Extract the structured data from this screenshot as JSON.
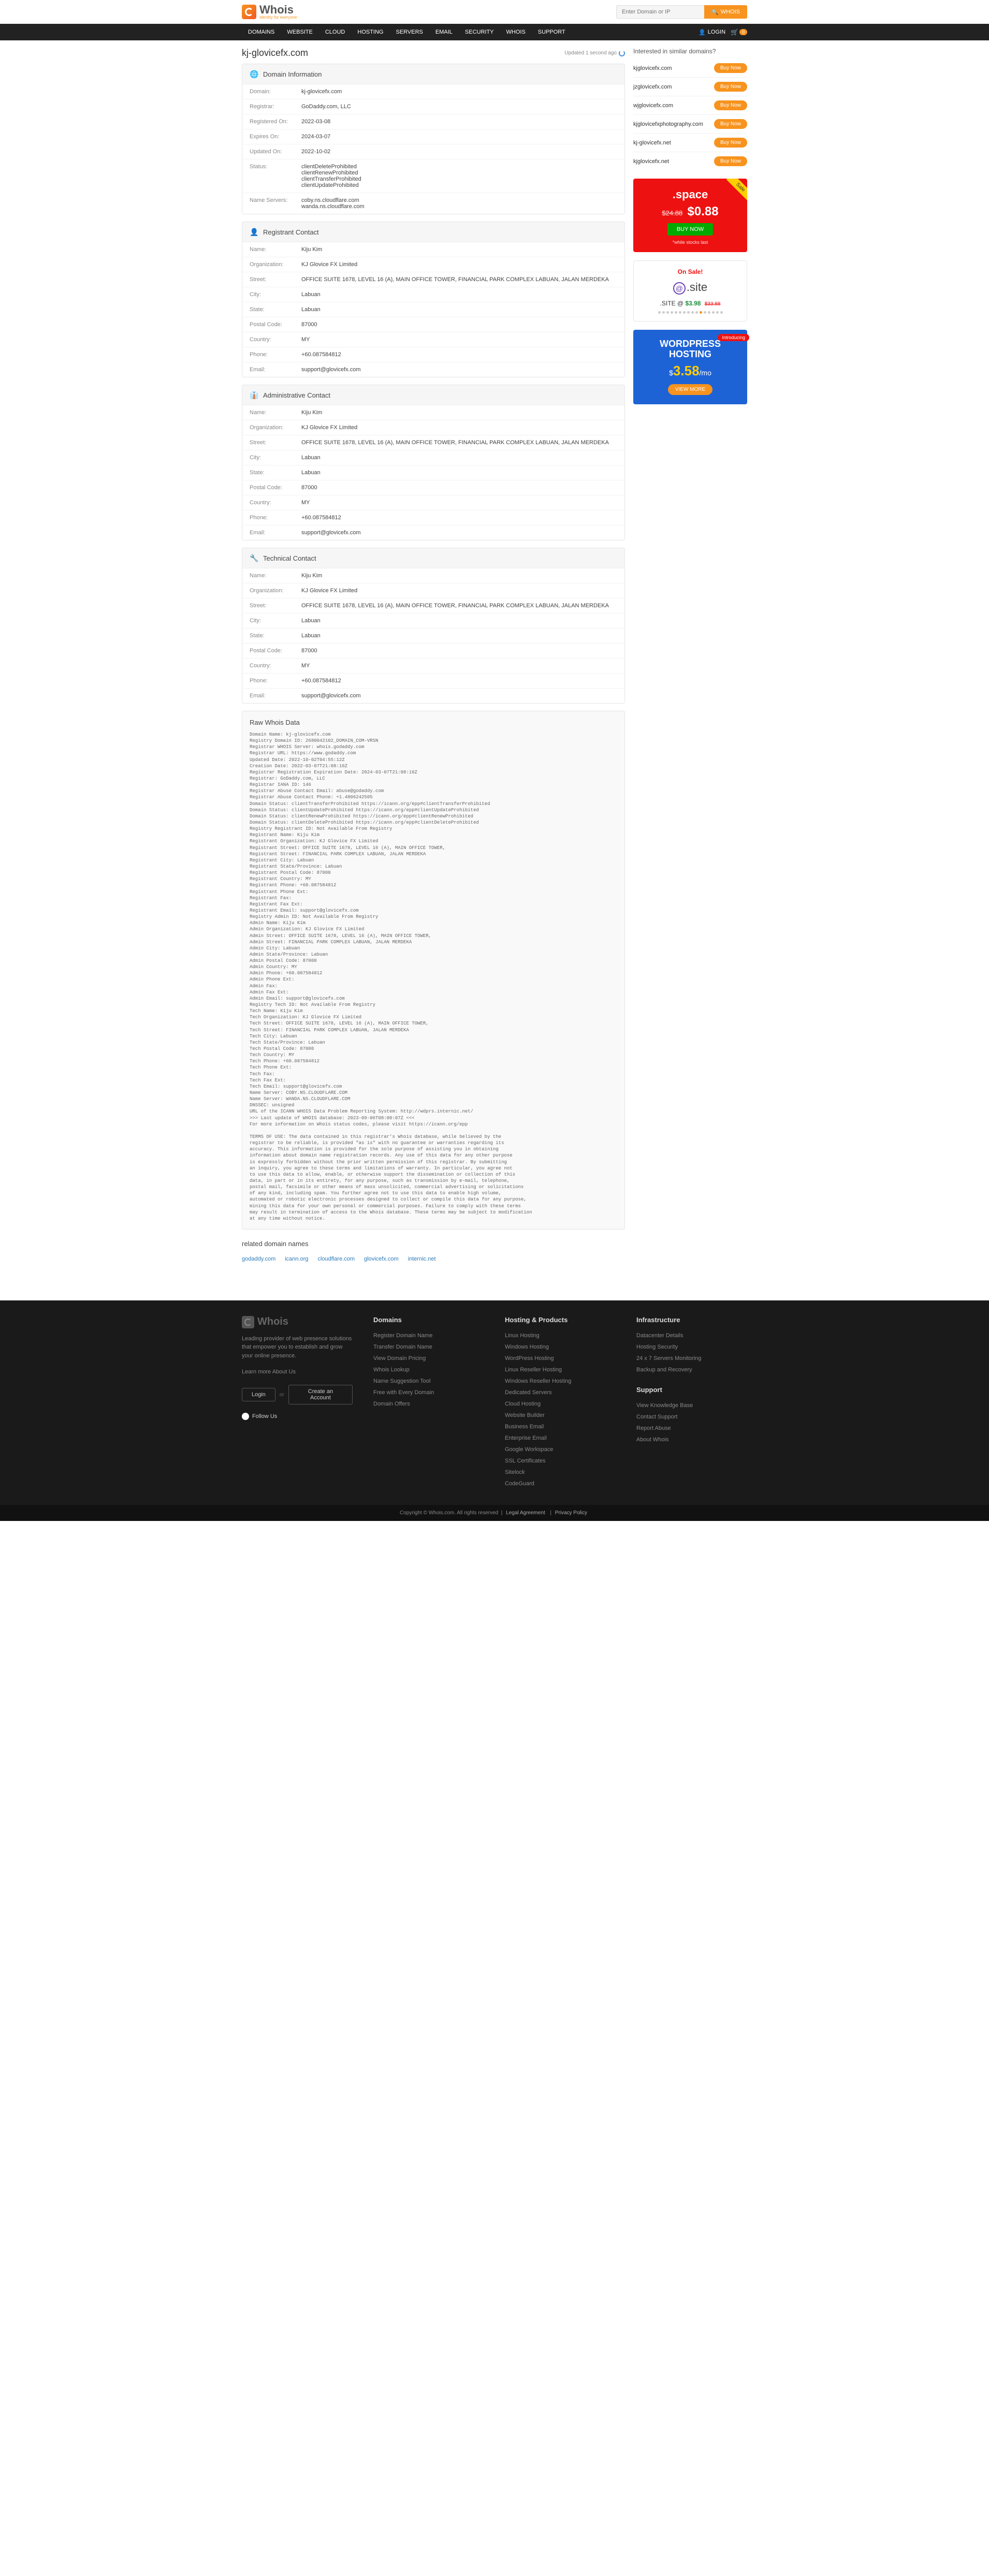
{
  "brand": {
    "name": "Whois",
    "tagline": "Identity for everyone"
  },
  "search": {
    "placeholder": "Enter Domain or IP",
    "btn": "WHOIS"
  },
  "nav": {
    "items": [
      "DOMAINS",
      "WEBSITE",
      "CLOUD",
      "HOSTING",
      "SERVERS",
      "EMAIL",
      "SECURITY",
      "WHOIS",
      "SUPPORT"
    ],
    "login": "LOGIN",
    "cart_count": "0"
  },
  "page": {
    "title": "kj-glovicefx.com",
    "updated": "Updated 1 second ago"
  },
  "domain_info": {
    "heading": "Domain Information",
    "rows": [
      {
        "k": "Domain:",
        "v": "kj-glovicefx.com"
      },
      {
        "k": "Registrar:",
        "v": "GoDaddy.com, LLC"
      },
      {
        "k": "Registered On:",
        "v": "2022-03-08"
      },
      {
        "k": "Expires On:",
        "v": "2024-03-07"
      },
      {
        "k": "Updated On:",
        "v": "2022-10-02"
      },
      {
        "k": "Status:",
        "v": "clientDeleteProhibited\nclientRenewProhibited\nclientTransferProhibited\nclientUpdateProhibited"
      },
      {
        "k": "Name Servers:",
        "v": "coby.ns.cloudflare.com\nwanda.ns.cloudflare.com"
      }
    ]
  },
  "contacts": [
    {
      "heading": "Registrant Contact",
      "icon": "👤",
      "rows": [
        {
          "k": "Name:",
          "v": "Kiju Kim"
        },
        {
          "k": "Organization:",
          "v": "KJ Glovice FX Limited"
        },
        {
          "k": "Street:",
          "v": "OFFICE SUITE 1678, LEVEL 16 (A), MAIN OFFICE TOWER, FINANCIAL PARK COMPLEX LABUAN, JALAN MERDEKA"
        },
        {
          "k": "City:",
          "v": "Labuan"
        },
        {
          "k": "State:",
          "v": "Labuan"
        },
        {
          "k": "Postal Code:",
          "v": "87000"
        },
        {
          "k": "Country:",
          "v": "MY"
        },
        {
          "k": "Phone:",
          "v": "+60.087584812"
        },
        {
          "k": "Email:",
          "v": "support@glovicefx.com"
        }
      ]
    },
    {
      "heading": "Administrative Contact",
      "icon": "👔",
      "rows": [
        {
          "k": "Name:",
          "v": "Kiju Kim"
        },
        {
          "k": "Organization:",
          "v": "KJ Glovice FX Limited"
        },
        {
          "k": "Street:",
          "v": "OFFICE SUITE 1678, LEVEL 16 (A), MAIN OFFICE TOWER, FINANCIAL PARK COMPLEX LABUAN, JALAN MERDEKA"
        },
        {
          "k": "City:",
          "v": "Labuan"
        },
        {
          "k": "State:",
          "v": "Labuan"
        },
        {
          "k": "Postal Code:",
          "v": "87000"
        },
        {
          "k": "Country:",
          "v": "MY"
        },
        {
          "k": "Phone:",
          "v": "+60.087584812"
        },
        {
          "k": "Email:",
          "v": "support@glovicefx.com"
        }
      ]
    },
    {
      "heading": "Technical Contact",
      "icon": "🔧",
      "rows": [
        {
          "k": "Name:",
          "v": "Kiju Kim"
        },
        {
          "k": "Organization:",
          "v": "KJ Glovice FX Limited"
        },
        {
          "k": "Street:",
          "v": "OFFICE SUITE 1678, LEVEL 16 (A), MAIN OFFICE TOWER, FINANCIAL PARK COMPLEX LABUAN, JALAN MERDEKA"
        },
        {
          "k": "City:",
          "v": "Labuan"
        },
        {
          "k": "State:",
          "v": "Labuan"
        },
        {
          "k": "Postal Code:",
          "v": "87000"
        },
        {
          "k": "Country:",
          "v": "MY"
        },
        {
          "k": "Phone:",
          "v": "+60.087584812"
        },
        {
          "k": "Email:",
          "v": "support@glovicefx.com"
        }
      ]
    }
  ],
  "raw": {
    "heading": "Raw Whois Data",
    "text": "Domain Name: kj-glovicefx.com\nRegistry Domain ID: 2680042102_DOMAIN_COM-VRSN\nRegistrar WHOIS Server: whois.godaddy.com\nRegistrar URL: https://www.godaddy.com\nUpdated Date: 2022-10-02T04:55:12Z\nCreation Date: 2022-03-07T21:08:16Z\nRegistrar Registration Expiration Date: 2024-03-07T21:08:16Z\nRegistrar: GoDaddy.com, LLC\nRegistrar IANA ID: 146\nRegistrar Abuse Contact Email: abuse@godaddy.com\nRegistrar Abuse Contact Phone: +1.4806242505\nDomain Status: clientTransferProhibited https://icann.org/epp#clientTransferProhibited\nDomain Status: clientUpdateProhibited https://icann.org/epp#clientUpdateProhibited\nDomain Status: clientRenewProhibited https://icann.org/epp#clientRenewProhibited\nDomain Status: clientDeleteProhibited https://icann.org/epp#clientDeleteProhibited\nRegistry Registrant ID: Not Available From Registry\nRegistrant Name: Kiju Kim\nRegistrant Organization: KJ Glovice FX Limited\nRegistrant Street: OFFICE SUITE 1678, LEVEL 16 (A), MAIN OFFICE TOWER,\nRegistrant Street: FINANCIAL PARK COMPLEX LABUAN, JALAN MERDEKA\nRegistrant City: Labuan\nRegistrant State/Province: Labuan\nRegistrant Postal Code: 87000\nRegistrant Country: MY\nRegistrant Phone: +60.087584812\nRegistrant Phone Ext:\nRegistrant Fax:\nRegistrant Fax Ext:\nRegistrant Email: support@glovicefx.com\nRegistry Admin ID: Not Available From Registry\nAdmin Name: Kiju Kim\nAdmin Organization: KJ Glovice FX Limited\nAdmin Street: OFFICE SUITE 1678, LEVEL 16 (A), MAIN OFFICE TOWER,\nAdmin Street: FINANCIAL PARK COMPLEX LABUAN, JALAN MERDEKA\nAdmin City: Labuan\nAdmin State/Province: Labuan\nAdmin Postal Code: 87000\nAdmin Country: MY\nAdmin Phone: +60.087584812\nAdmin Phone Ext:\nAdmin Fax:\nAdmin Fax Ext:\nAdmin Email: support@glovicefx.com\nRegistry Tech ID: Not Available From Registry\nTech Name: Kiju Kim\nTech Organization: KJ Glovice FX Limited\nTech Street: OFFICE SUITE 1678, LEVEL 16 (A), MAIN OFFICE TOWER,\nTech Street: FINANCIAL PARK COMPLEX LABUAN, JALAN MERDEKA\nTech City: Labuan\nTech State/Province: Labuan\nTech Postal Code: 87000\nTech Country: MY\nTech Phone: +60.087584812\nTech Phone Ext:\nTech Fax:\nTech Fax Ext:\nTech Email: support@glovicefx.com\nName Server: COBY.NS.CLOUDFLARE.COM\nName Server: WANDA.NS.CLOUDFLARE.COM\nDNSSEC: unsigned\nURL of the ICANN WHOIS Data Problem Reporting System: http://wdprs.internic.net/\n>>> Last update of WHOIS database: 2023-09-06T08:00:07Z <<<\nFor more information on Whois status codes, please visit https://icann.org/epp\n\nTERMS OF USE: The data contained in this registrar's Whois database, while believed by the\nregistrar to be reliable, is provided \"as is\" with no guarantee or warranties regarding its\naccuracy. This information is provided for the sole purpose of assisting you in obtaining\ninformation about domain name registration records. Any use of this data for any other purpose\nis expressly forbidden without the prior written permission of this registrar. By submitting\nan inquiry, you agree to these terms and limitations of warranty. In particular, you agree not\nto use this data to allow, enable, or otherwise support the dissemination or collection of this\ndata, in part or in its entirety, for any purpose, such as transmission by e-mail, telephone,\npostal mail, facsimile or other means of mass unsolicited, commercial advertising or solicitations\nof any kind, including spam. You further agree not to use this data to enable high volume,\nautomated or robotic electronic processes designed to collect or compile this data for any purpose,\nmining this data for your own personal or commercial purposes. Failure to comply with these terms\nmay result in termination of access to the Whois database. These terms may be subject to modification\nat any time without notice."
  },
  "related": {
    "heading": "related domain names",
    "links": [
      "godaddy.com",
      "icann.org",
      "cloudflare.com",
      "glovicefx.com",
      "internic.net"
    ]
  },
  "similar": {
    "heading": "Interested in similar domains?",
    "items": [
      {
        "name": "kjglovicefx.com",
        "btn": "Buy Now"
      },
      {
        "name": "jzglovicefx.com",
        "btn": "Buy Now"
      },
      {
        "name": "wjglovicefx.com",
        "btn": "Buy Now"
      },
      {
        "name": "kjglovicefxphotography.com",
        "btn": "Buy Now"
      },
      {
        "name": "kj-glovicefx.net",
        "btn": "Buy Now"
      },
      {
        "name": "kjglovicefx.net",
        "btn": "Buy Now"
      }
    ]
  },
  "promo_space": {
    "badge": "Sale",
    "tld": ".space",
    "old": "$24.88",
    "new": "$0.88",
    "btn": "BUY NOW",
    "stock": "*while stocks last"
  },
  "promo_site": {
    "onsale": "On Sale!",
    "logo": ".site",
    "line": ".SITE @ ",
    "now": "$3.98",
    "was": "$33.88"
  },
  "promo_wp": {
    "intro": "Introducing",
    "title1": "WORDPRESS",
    "title2": "HOSTING",
    "currency": "$",
    "big": "3.58",
    "per": "/mo",
    "btn": "VIEW MORE"
  },
  "footer": {
    "tagline": "Leading provider of web presence solutions that empower you to establish and grow your online presence.",
    "learn": "Learn more About Us",
    "login": "Login",
    "or": "or",
    "create": "Create an Account",
    "follow": "Follow Us",
    "cols": [
      {
        "h": "Domains",
        "links": [
          "Register Domain Name",
          "Transfer Domain Name",
          "View Domain Pricing",
          "Whois Lookup",
          "Name Suggestion Tool",
          "Free with Every Domain",
          "Domain Offers"
        ]
      },
      {
        "h": "Hosting & Products",
        "links": [
          "Linux Hosting",
          "Windows Hosting",
          "WordPress Hosting",
          "Linux Reseller Hosting",
          "Windows Reseller Hosting",
          "Dedicated Servers",
          "Cloud Hosting",
          "Website Builder",
          "Business Email",
          "Enterprise Email",
          "Google Workspace",
          "SSL Certificates",
          "Sitelock",
          "CodeGuard"
        ]
      },
      {
        "h": "Infrastructure",
        "links": [
          "Datacenter Details",
          "Hosting Security",
          "24 x 7 Servers Monitoring",
          "Backup and Recovery"
        ],
        "h2": "Support",
        "links2": [
          "View Knowledge Base",
          "Contact Support",
          "Report Abuse",
          "About Whois"
        ]
      }
    ],
    "copyright": "Copyright © Whois.com. All rights reserved",
    "legal": "Legal Agreement",
    "privacy": "Privacy Policy"
  }
}
